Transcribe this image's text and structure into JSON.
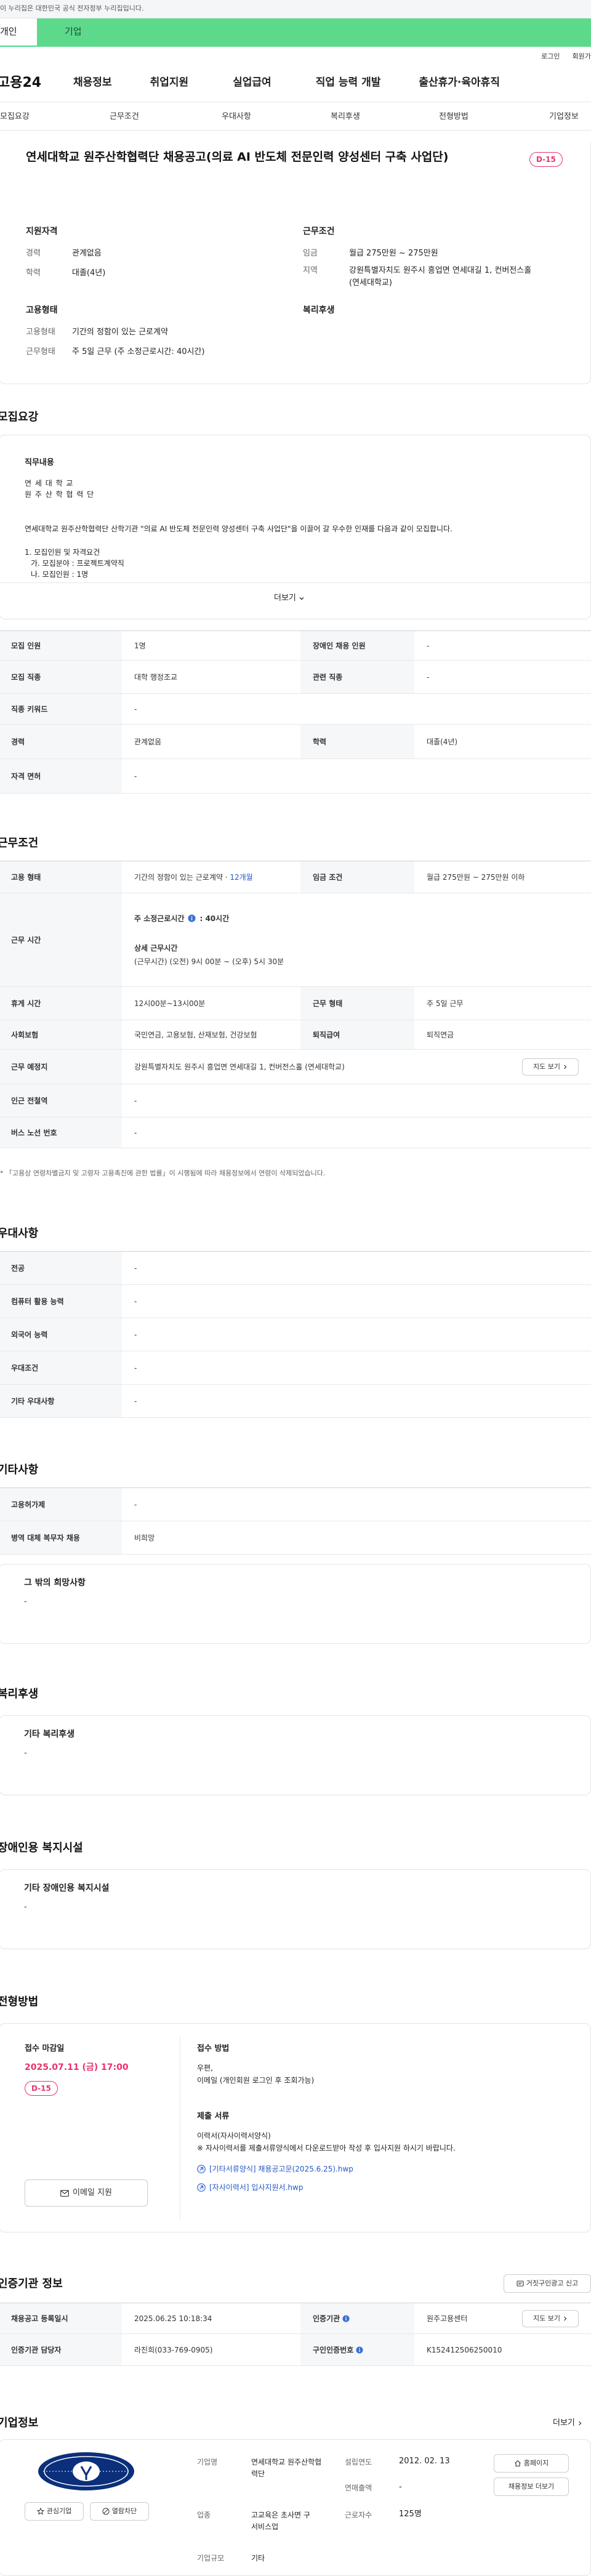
{
  "notice": "이 누리집은 대한민국 공식 전자정부 누리집입니다.",
  "user_tabs": {
    "individual": "개인",
    "company": "기업"
  },
  "util": {
    "login": "로그인",
    "join": "회원가입"
  },
  "gnb": {
    "logo": "고용24",
    "menu": [
      "채용정보",
      "취업지원",
      "실업급여",
      "직업 능력 개발",
      "출산휴가·육아휴직"
    ]
  },
  "subnav": [
    "모집요강",
    "근무조건",
    "우대사항",
    "복리후생",
    "전형방법",
    "기업정보"
  ],
  "job": {
    "title": "연세대학교 원주산학협력단 채용공고(의료 AI 반도체 전문인력 양성센터 구축 사업단)",
    "dday": "D-15"
  },
  "summary": {
    "qual_label": "지원자격",
    "career_k": "경력",
    "career_v": "관계없음",
    "edu_k": "학력",
    "edu_v": "대졸(4년)",
    "cond_label": "근무조건",
    "wage_k": "임금",
    "wage_v": "월급 275만원 ~ 275만원",
    "loc_k": "지역",
    "loc_v": "강원특별자치도 원주시 흥업면 연세대길 1, 컨버전스홀(연세대학교)",
    "emp_label": "고용형태",
    "emptype_k": "고용형태",
    "emptype_v": "기간의 정함이 있는 근로계약",
    "worktype_k": "근무형태",
    "worktype_v": "주 5일 근무 (주 소정근로시간: 40시간)",
    "welfare_label": "복리후생"
  },
  "recruit": {
    "title": "모집요강",
    "duty_label": "직무내용",
    "duty_lines": [
      "연 세 대 학 교",
      "원 주 산 학 협 력 단",
      "연세대학교 원주산학협력단 산학기관 \"의료 AI 반도체 전문인력 양성센터 구축 사업단\"을 이끌어 갈 우수한 인재를 다음과 같이 모집합니다.",
      "1. 모집인원 및 자격요건",
      "가. 모집분야 : 프로젝트계약직",
      "나. 모집인원 : 1명"
    ],
    "more": "더보기",
    "rows": [
      {
        "k1": "모집 인원",
        "v1": "1명",
        "k2": "장애인 채용 인원",
        "v2": "-"
      },
      {
        "k1": "모집 직종",
        "v1": "대학 행정조교",
        "k2": "관련 직종",
        "v2": "-"
      },
      {
        "k1": "직종 키워드",
        "v1": "-"
      },
      {
        "k1": "경력",
        "v1": "관계없음",
        "k2": "학력",
        "v2": "대졸(4년)"
      },
      {
        "k1": "자격 면허",
        "v1": "-"
      }
    ]
  },
  "work": {
    "title": "근무조건",
    "emp_k": "고용 형태",
    "emp_v": "기간의 정함이 있는 근로계약 · ",
    "emp_v2": "12개월",
    "wage_k": "임금 조건",
    "wage_v": "월급 275만원 ~ 275만원 이하",
    "time_k": "근무 시간",
    "weekly": "주 소정근로시간",
    "weekly_v": ": 40시간",
    "detail": "상세 근무시간",
    "detail_v": "(근무시간) (오전) 9시 00분 ~ (오후) 5시 30분",
    "rest_k": "휴게 시간",
    "rest_v": "12시00분~13시00분",
    "form_k": "근무 형태",
    "form_v": "주 5일 근무",
    "ins_k": "사회보험",
    "ins_v": "국민연금, 고용보험, 산재보험, 건강보험",
    "sev_k": "퇴직급여",
    "sev_v": "퇴직연금",
    "place_k": "근무 예정지",
    "place_v": "강원특별자치도 원주시 흥업면 연세대길 1, 컨버전스홀 (연세대학교)",
    "map_btn": "지도 보기",
    "subway_k": "인근 전철역",
    "subway_v": "-",
    "bus_k": "버스 노선 번호",
    "bus_v": "-",
    "note": "* 「고용상 연령차별금지 및 고령자 고용촉진에 관한 법률」이 시행됨에 따라 채용정보에서 연령이 삭제되었습니다."
  },
  "prefer": {
    "title": "우대사항",
    "rows": [
      [
        "전공",
        "-"
      ],
      [
        "컴퓨터 활용 능력",
        "-"
      ],
      [
        "외국어 능력",
        "-"
      ],
      [
        "우대조건",
        "-"
      ],
      [
        "기타 우대사항",
        "-"
      ]
    ]
  },
  "etc": {
    "title": "기타사항",
    "rows": [
      [
        "고용허가제",
        "-"
      ],
      [
        "병역 대체 복무자 채용",
        "비희망"
      ]
    ],
    "hope_label": "그 밖의 희망사항",
    "hope_v": "-"
  },
  "welfare": {
    "title": "복리후생",
    "label": "기타 복리후생",
    "v": "-"
  },
  "disabled": {
    "title": "장애인용 복지시설",
    "label": "기타 장애인용 복지시설",
    "v": "-"
  },
  "process": {
    "title": "전형방법",
    "deadline_label": "접수 마감일",
    "deadline": "2025.07.11 (금) 17:00",
    "dday": "D-15",
    "apply_btn": "이메일 지원",
    "method_label": "접수 방법",
    "method_v1": "우편,",
    "method_v2": "이메일 (개인회원 로그인 후 조회가능)",
    "docs_label": "제출 서류",
    "docs_v1": "이력서(자사이력서양식)",
    "docs_v2": "※ 자사이력서를 제출서류양식에서 다운로드받아 작성 후 입사지원 하시기 바랍니다.",
    "file1": "[기타서류양식] 채용공고문(2025.6.25).hwp",
    "file2": "[자사이력서] 입사지원서.hwp"
  },
  "cert": {
    "title": "인증기관 정보",
    "report_btn": "거짓구인광고 신고",
    "reg_k": "채용공고 등록일시",
    "reg_v": "2025.06.25 10:18:34",
    "agency_k": "인증기관",
    "agency_v": "원주고용센터",
    "map_btn": "지도 보기",
    "staff_k": "인증기관 담당자",
    "staff_v": "라진희(033-769-0905)",
    "id_k": "구인인증번호",
    "id_v": "K152412506250010"
  },
  "company": {
    "title": "기업정보",
    "more": "더보기",
    "interest": "관심기업",
    "block": "열람차단",
    "name_k": "기업명",
    "name_v": "연세대학교 원주산학협력단",
    "ind_k": "업종",
    "ind_v": "고교육은 초사면 구 서비스업",
    "scale_k": "기업규모",
    "scale_v": "기타",
    "est_k": "설립연도",
    "est_v": "2012. 02. 13",
    "sales_k": "연매출액",
    "sales_v": "-",
    "emp_k": "근로자수",
    "emp_v": "125명",
    "home_btn": "홈페이지",
    "list_btn": "채용정보 더보기"
  }
}
